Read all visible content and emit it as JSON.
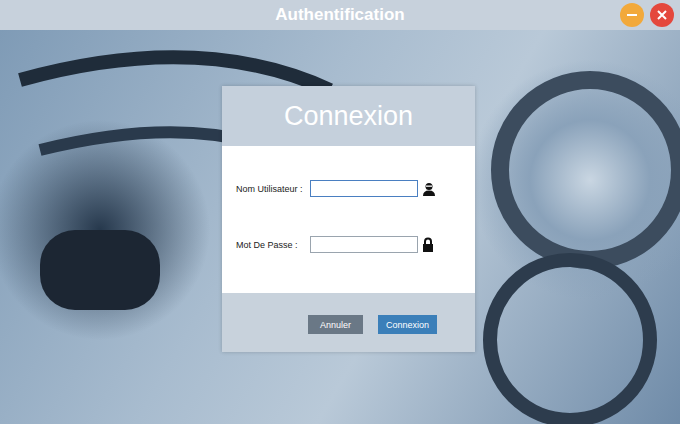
{
  "window": {
    "title": "Authentification"
  },
  "dialog": {
    "title": "Connexion",
    "fields": [
      {
        "label": "Nom Utilisateur :",
        "value": "",
        "focused": true,
        "kind": "user"
      },
      {
        "label": "Mot De Passe :",
        "value": "",
        "focused": false,
        "kind": "password"
      }
    ],
    "buttons": [
      "Annuler",
      "Connexion"
    ]
  }
}
